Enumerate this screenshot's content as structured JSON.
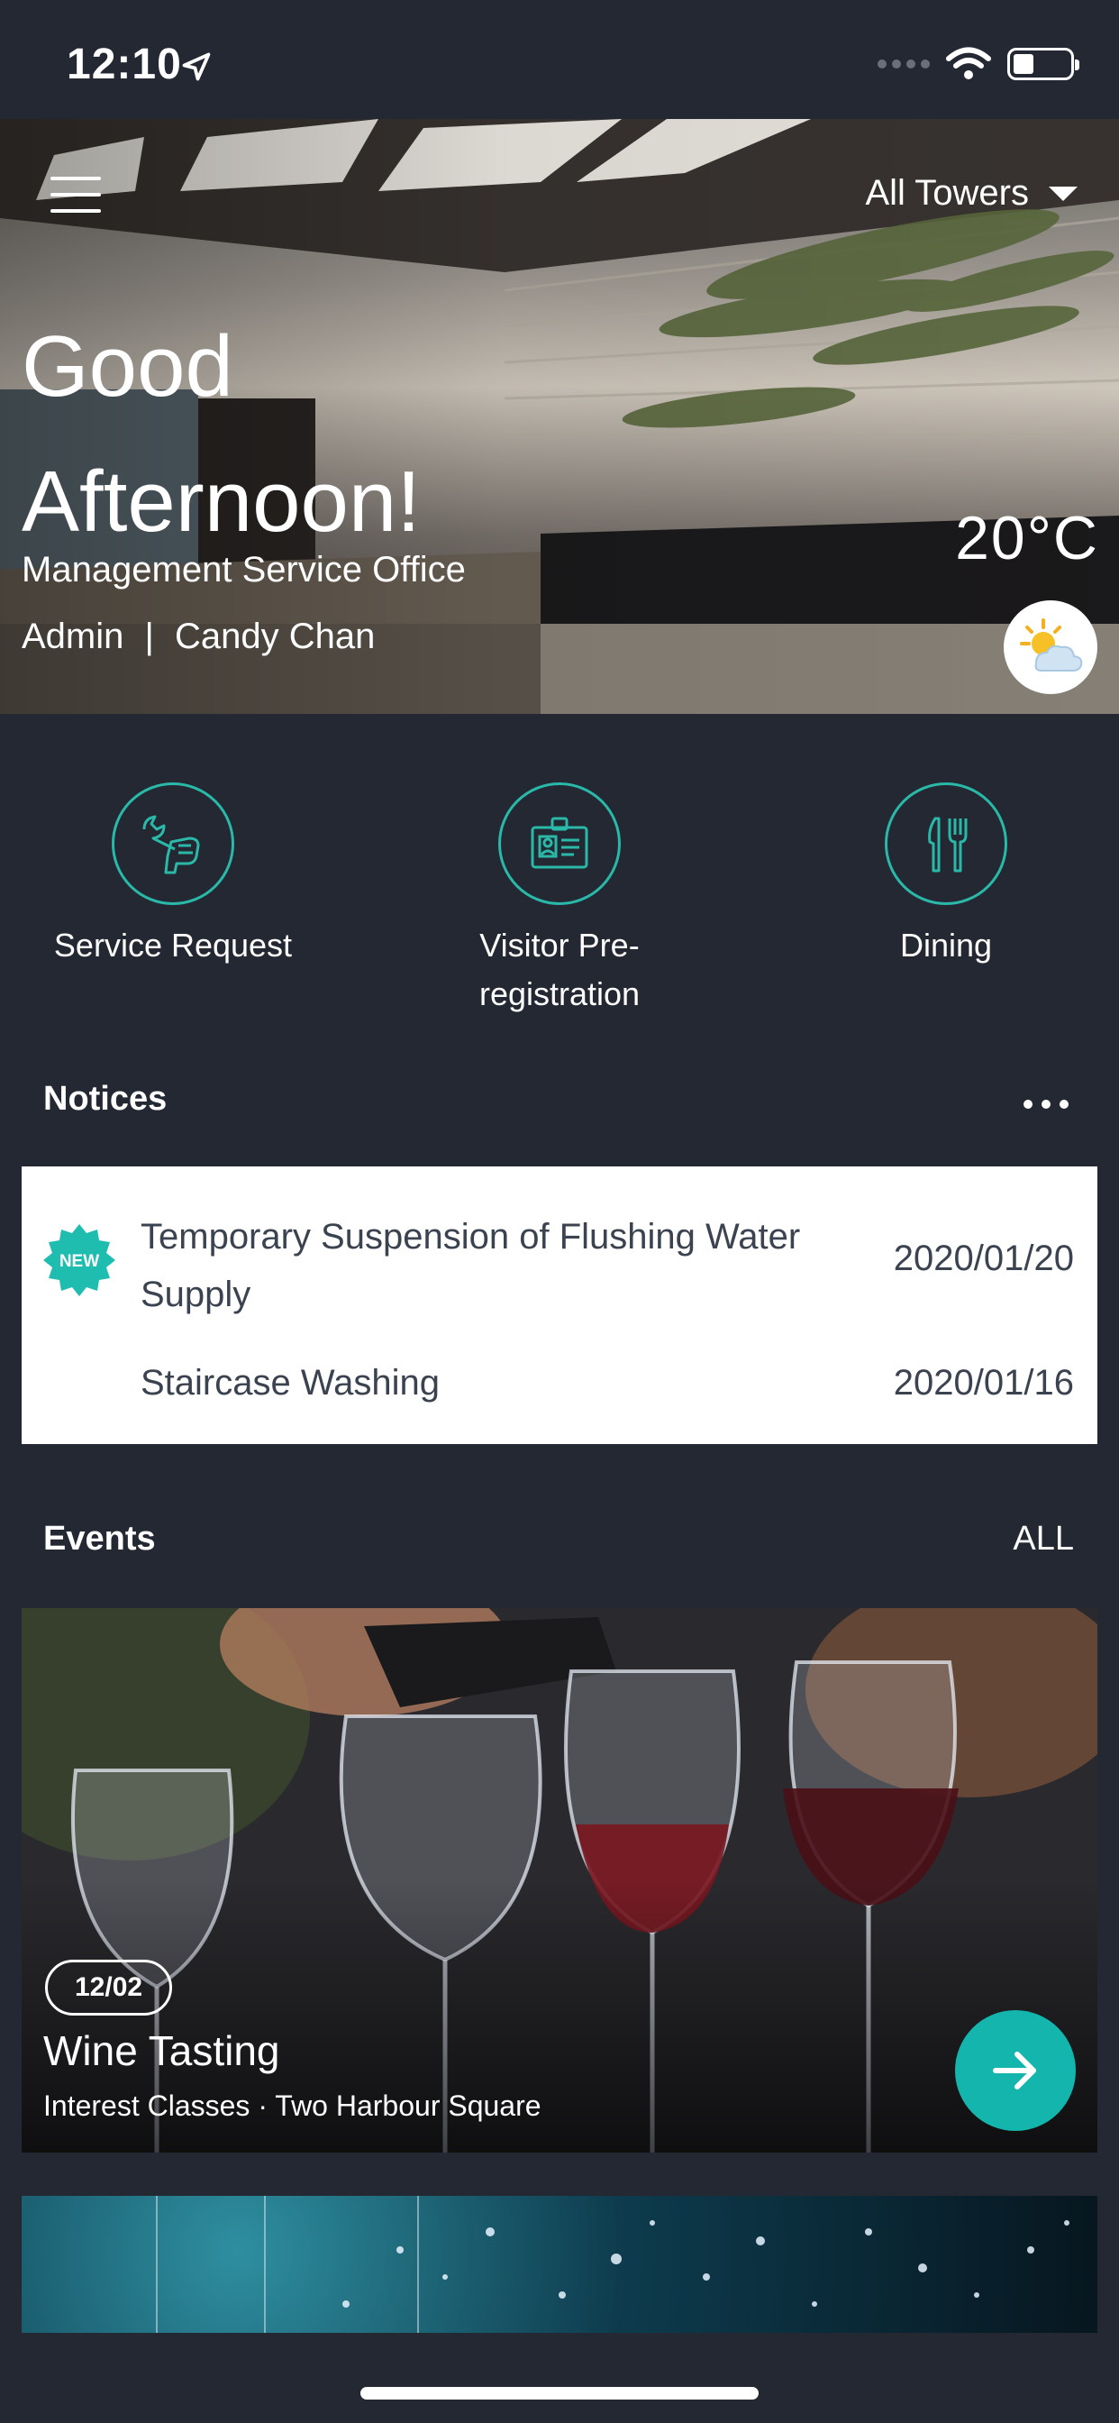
{
  "status_bar": {
    "time": "12:10"
  },
  "header": {
    "tower_selector": "All Towers",
    "greeting": "Good Afternoon!",
    "office": "Management Service Office",
    "role": "Admin",
    "separator": "|",
    "user_name": "Candy Chan",
    "temperature": "20°C",
    "weather_icon": "partly-cloudy-icon"
  },
  "quick_actions": [
    {
      "label": "Service Request",
      "icon": "wrench-hand-icon"
    },
    {
      "label": "Visitor Pre-registration",
      "icon": "id-badge-icon"
    },
    {
      "label": "Dining",
      "icon": "fork-knife-icon"
    }
  ],
  "notices": {
    "title": "Notices",
    "items": [
      {
        "title": "Temporary Suspension of Flushing Water Supply",
        "date": "2020/01/20",
        "badge": "NEW"
      },
      {
        "title": "Staircase Washing",
        "date": "2020/01/16"
      }
    ]
  },
  "events": {
    "title": "Events",
    "all_label": "ALL",
    "items": [
      {
        "date": "12/02",
        "title": "Wine Tasting",
        "subtitle": "Interest Classes · Two Harbour Square"
      }
    ]
  },
  "colors": {
    "accent": "#14b5ad",
    "background": "#232833",
    "card": "#ffffff"
  }
}
